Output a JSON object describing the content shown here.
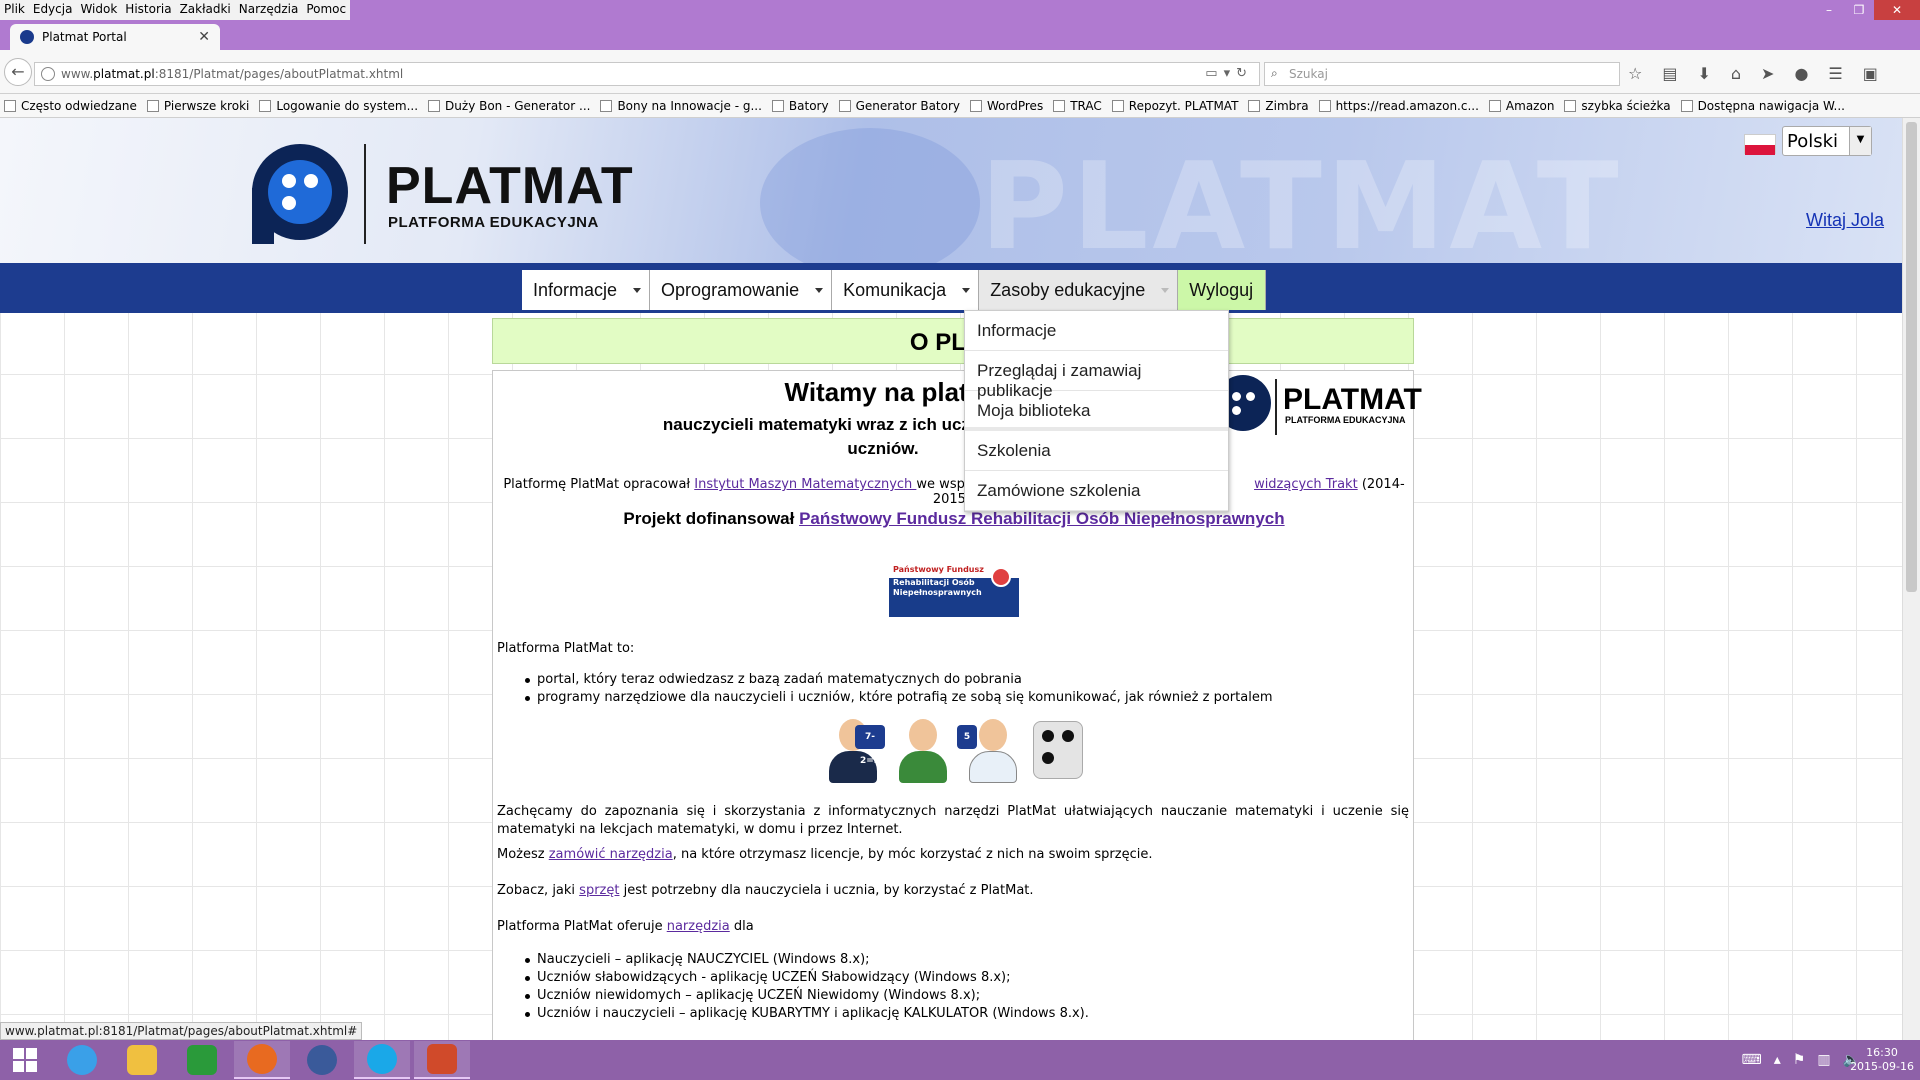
{
  "browser": {
    "menu": [
      "Plik",
      "Edycja",
      "Widok",
      "Historia",
      "Zakładki",
      "Narzędzia",
      "Pomoc"
    ],
    "tab_title": "Platmat Portal",
    "url_prefix": "www.",
    "url_host": "platmat.pl",
    "url_path": ":8181/Platmat/pages/aboutPlatmat.xhtml",
    "search_placeholder": "Szukaj",
    "bookmarks": [
      "Często odwiedzane",
      "Pierwsze kroki",
      "Logowanie do system...",
      "Duży Bon - Generator ...",
      "Bony na Innowacje - g...",
      "Batory",
      "Generator Batory",
      "WordPres",
      "TRAC",
      "Repozyt. PLATMAT",
      "Zimbra",
      "https://read.amazon.c...",
      "Amazon",
      "szybka ścieżka",
      "Dostępna nawigacja W..."
    ],
    "status_url": "www.platmat.pl:8181/Platmat/pages/aboutPlatmat.xhtml#"
  },
  "header": {
    "logo_title": "PLATMAT",
    "logo_subtitle": "PLATFORMA EDUKACYJNA",
    "language": "Polski",
    "greeting": "Witaj Jola"
  },
  "nav": {
    "items": [
      "Informacje",
      "Oprogramowanie",
      "Komunikacja",
      "Zasoby edukacyjne"
    ],
    "logout": "Wyloguj",
    "dropdown": [
      "Informacje",
      "Przeglądaj i zamawiaj publikacje",
      "Moja biblioteka",
      "Szkolenia",
      "Zamówione szkolenia"
    ]
  },
  "page": {
    "header_visible": "O PLAT",
    "welcome": "Witamy na platformie Pla",
    "subwelcome_line1": "nauczycieli matematyki wraz z ich uczniami niesprawn",
    "subwelcome_line2": "uczniów.",
    "small_logo_title": "PLATMAT",
    "small_logo_subtitle": "PLATFORMA EDUKACYJNA",
    "credit_prefix": "Platformę PlatMat opracował ",
    "credit_link": "Instytut Maszyn Matematycznych ",
    "credit_middle": "we współpra",
    "credit_link2": "widzących Trakt",
    "credit_suffix": " (2014-2015).",
    "funded_prefix": "Projekt dofinansował ",
    "funded_link": "Państwowy Fundusz Rehabilitacji Osób Niepełnosprawnych",
    "pfron_logo_line1": "Państwowy Fundusz",
    "pfron_logo_line2": "Rehabilitacji Osób",
    "pfron_logo_line3": "Niepełnosprawnych",
    "intro": "Platforma PlatMat to:",
    "list1": [
      "portal, który teraz odwiedzasz z bazą zadań matematycznych do pobrania",
      "programy narzędziowe dla nauczycieli i uczniów, które potrafią ze sobą się komunikować, jak również z portalem"
    ],
    "avatar_badges": [
      "7-2=5",
      "5"
    ],
    "p1": "Zachęcamy do zapoznania się i skorzystania z informatycznych narzędzi PlatMat ułatwiających nauczanie matematyki i uczenie się matematyki na lekcjach matematyki, w domu i przez Internet.",
    "p2_prefix": "Możesz ",
    "p2_link": "zamówić narzędzia",
    "p2_suffix": ", na które otrzymasz licencje, by móc korzystać z nich na swoim sprzęcie.",
    "p3_prefix": "Zobacz, jaki ",
    "p3_link": "sprzęt",
    "p3_suffix": " jest potrzebny dla nauczyciela i ucznia, by korzystać z PlatMat.",
    "p4_prefix": "Platforma PlatMat oferuje ",
    "p4_link": "narzędzia",
    "p4_suffix": " dla",
    "list2": [
      "Nauczycieli – aplikację NAUCZYCIEL (Windows 8.x);",
      "Uczniów słabowidzących - aplikację UCZEŃ Słabowidzący (Windows 8.x);",
      "Uczniów niewidomych – aplikację UCZEŃ Niewidomy (Windows 8.x);",
      "Uczniów i nauczycieli – aplikację KUBARYTMY i aplikację KALKULATOR (Windows 8.x)."
    ]
  },
  "taskbar": {
    "time": "16:30",
    "date": "2015-09-16",
    "icons": [
      "internet-explorer-icon",
      "file-explorer-icon",
      "store-icon",
      "firefox-icon",
      "thunderbird-icon",
      "skype-icon",
      "powerpoint-icon"
    ]
  },
  "colors": {
    "titlebar": "#b07ad0",
    "navstrip": "#1d3c8f",
    "logout_bg": "#ccf7a8",
    "header_box": "#e2fcc4",
    "link": "#5b2a9e",
    "taskbar": "#8e61a8"
  }
}
